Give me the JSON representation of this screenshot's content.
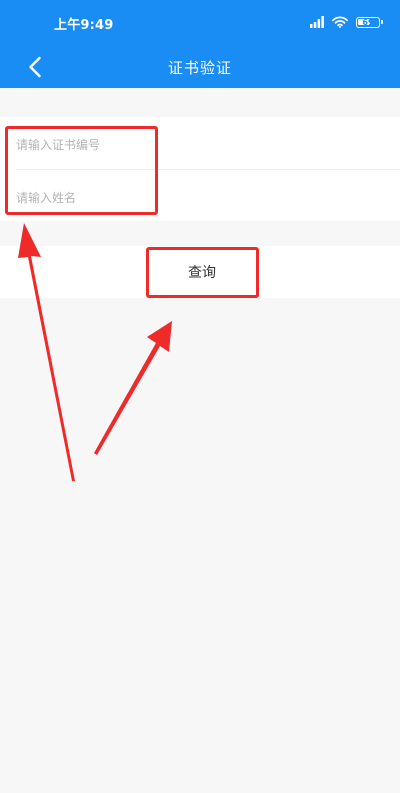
{
  "status_bar": {
    "time": "上午9:49",
    "signal_icon": "signal-icon",
    "wifi_icon": "wifi-icon",
    "battery_icon": "battery-icon",
    "battery_level": "69",
    "battery_fraction": 0.69
  },
  "nav": {
    "back_icon": "chevron-left-icon",
    "title": "证书验证"
  },
  "form": {
    "cert_number": {
      "placeholder": "请输入证书编号",
      "value": ""
    },
    "name": {
      "placeholder": "请输入姓名",
      "value": ""
    }
  },
  "query": {
    "label": "查询"
  },
  "colors": {
    "primary": "#1a8df5",
    "background": "#f7f7f7",
    "card": "#ffffff",
    "annotation": "#ee2a2a",
    "placeholder": "#b4b4b4",
    "text": "#333333"
  }
}
